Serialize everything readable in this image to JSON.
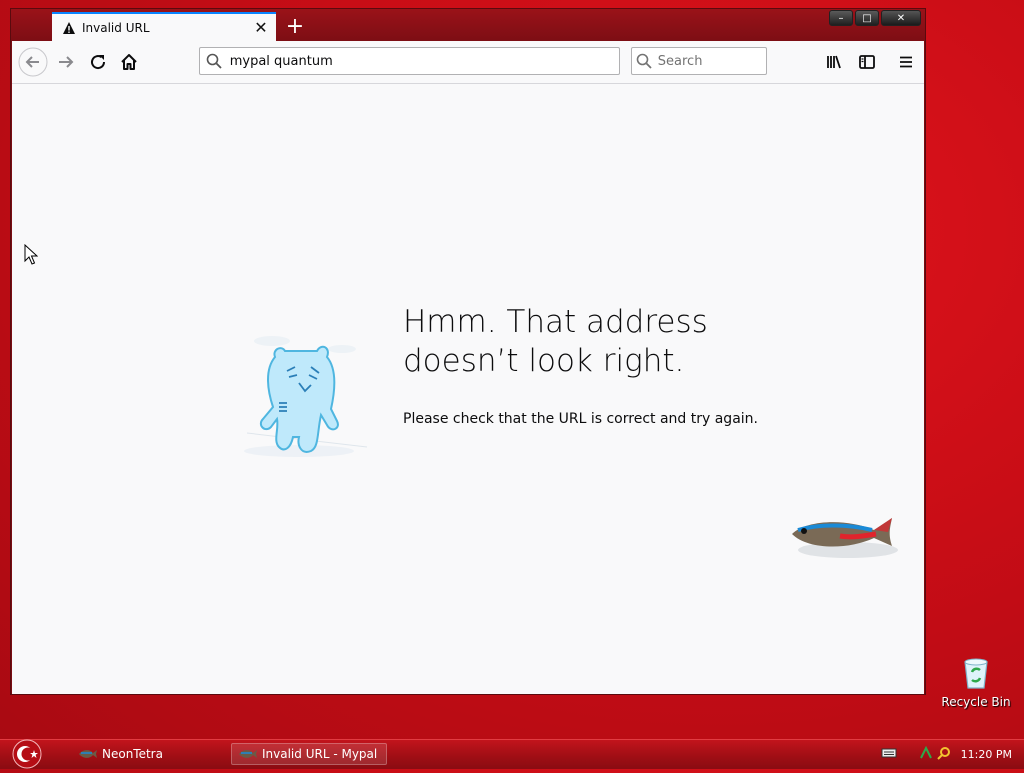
{
  "browser": {
    "tab": {
      "title": "Invalid URL",
      "close": "✕"
    },
    "new_tab": "+",
    "window_controls": {
      "minimize": "–",
      "maximize": "□",
      "close": "✕"
    },
    "toolbar": {
      "url_value": "mypal quantum",
      "search_placeholder": "Search",
      "icons": [
        "back-arrow-icon",
        "forward-arrow-icon",
        "reload-icon",
        "home-icon",
        "library-icon",
        "sidebar-icon",
        "menu-icon"
      ]
    },
    "error_page": {
      "headline": "Hmm. That address doesn’t look right.",
      "message": "Please check that the URL is correct and try again."
    }
  },
  "desktop": {
    "icons": [
      {
        "label": "Recycle Bin"
      }
    ]
  },
  "taskbar": {
    "items": [
      {
        "label": "NeonTetra"
      },
      {
        "label": "Invalid URL - Mypal"
      }
    ],
    "clock": "11:20 PM"
  },
  "colors": {
    "accent": "#0a84ff",
    "desktop": "#c90d16",
    "page_bg": "#f9f9fa"
  }
}
